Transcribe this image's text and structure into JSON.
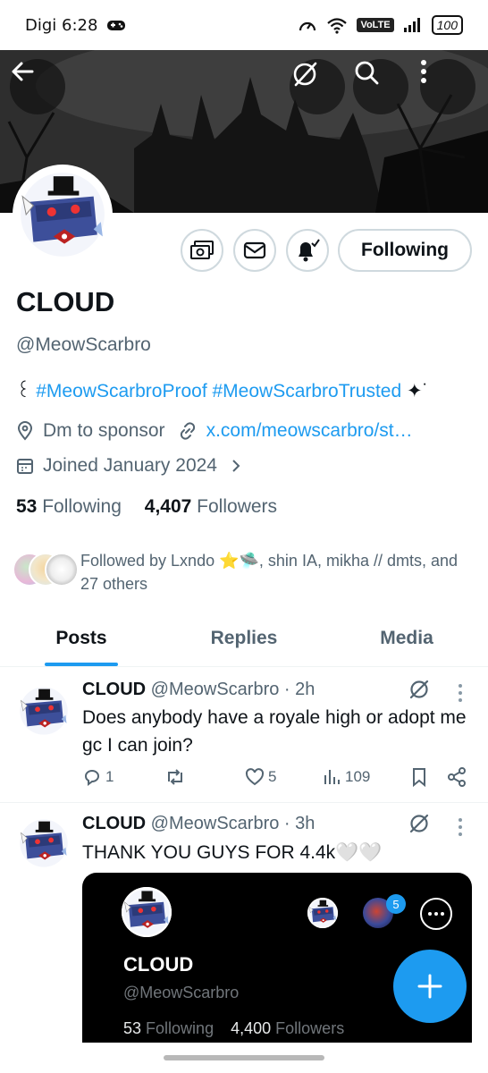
{
  "status_bar": {
    "carrier_time": "Digi 6:28",
    "network": "VoLTE",
    "battery": "100"
  },
  "profile": {
    "name": "CLOUD",
    "handle": "@MeowScarbro",
    "bio_prefix": "꒰",
    "bio_hashtags": "#MeowScarbroProof #MeowScarbroTrusted",
    "bio_suffix": "✦˙",
    "location": "Dm to sponsor",
    "website": "x.com/meowscarbro/st…",
    "joined": "Joined January 2024",
    "following_count": "53",
    "following_label": "Following",
    "followers_count": "4,407",
    "followers_label": "Followers",
    "followed_by": "Followed by Lxndo ⭐🛸, shin IA, mikha // dmts, and 27 others",
    "follow_button": "Following"
  },
  "tabs": [
    {
      "label": "Posts"
    },
    {
      "label": "Replies"
    },
    {
      "label": "Media"
    }
  ],
  "posts": [
    {
      "name": "CLOUD",
      "handle_time": "@MeowScarbro · 2h",
      "text": "Does anybody have a royale high or adopt me gc I can join?",
      "replies": "1",
      "reposts": "",
      "likes": "5",
      "views": "109"
    },
    {
      "name": "CLOUD",
      "handle_time": "@MeowScarbro · 3h",
      "text": "THANK YOU GUYS FOR 4.4k🤍🤍"
    }
  ],
  "embed": {
    "name": "CLOUD",
    "handle": "@MeowScarbro",
    "following_count": "53",
    "following_label": "Following",
    "followers_count": "4,400",
    "followers_label": "Followers",
    "badge": "5"
  },
  "colors": {
    "accent": "#1d9bf0",
    "text": "#0f1419",
    "muted": "#536471",
    "border": "#cfd9de"
  }
}
